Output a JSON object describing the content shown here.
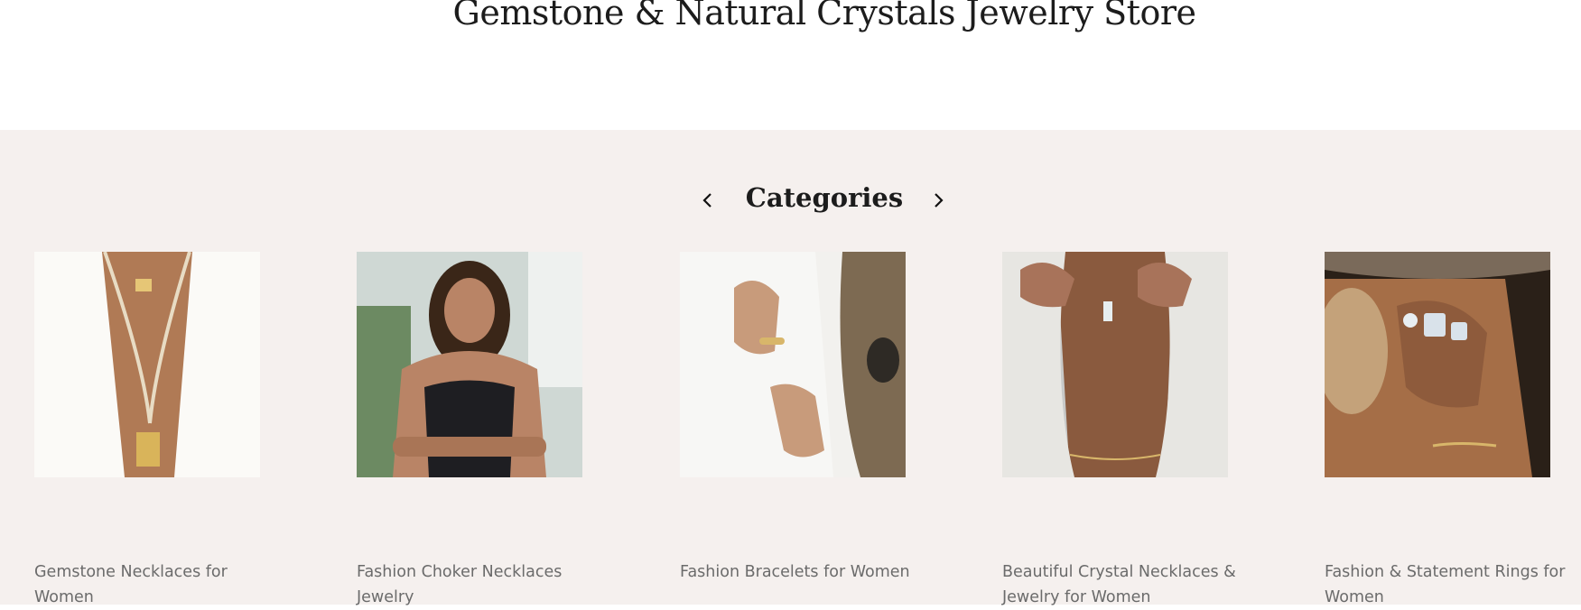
{
  "header": {
    "store_title": "Gemstone & Natural Crystals Jewelry Store"
  },
  "categories": {
    "title": "Categories",
    "prev_icon": "chevron-left-icon",
    "next_icon": "chevron-right-icon",
    "items": [
      {
        "label": "Gemstone Necklaces for Women"
      },
      {
        "label": "Fashion Choker Necklaces Jewelry"
      },
      {
        "label": "Fashion Bracelets for Women"
      },
      {
        "label": "Beautiful Crystal Necklaces & Jewelry for Women"
      },
      {
        "label": "Fashion & Statement Rings for Women"
      }
    ]
  },
  "colors": {
    "section_bg": "#f5f0ee",
    "label_text": "#6b6b6b",
    "title_text": "#1c1c1c"
  }
}
